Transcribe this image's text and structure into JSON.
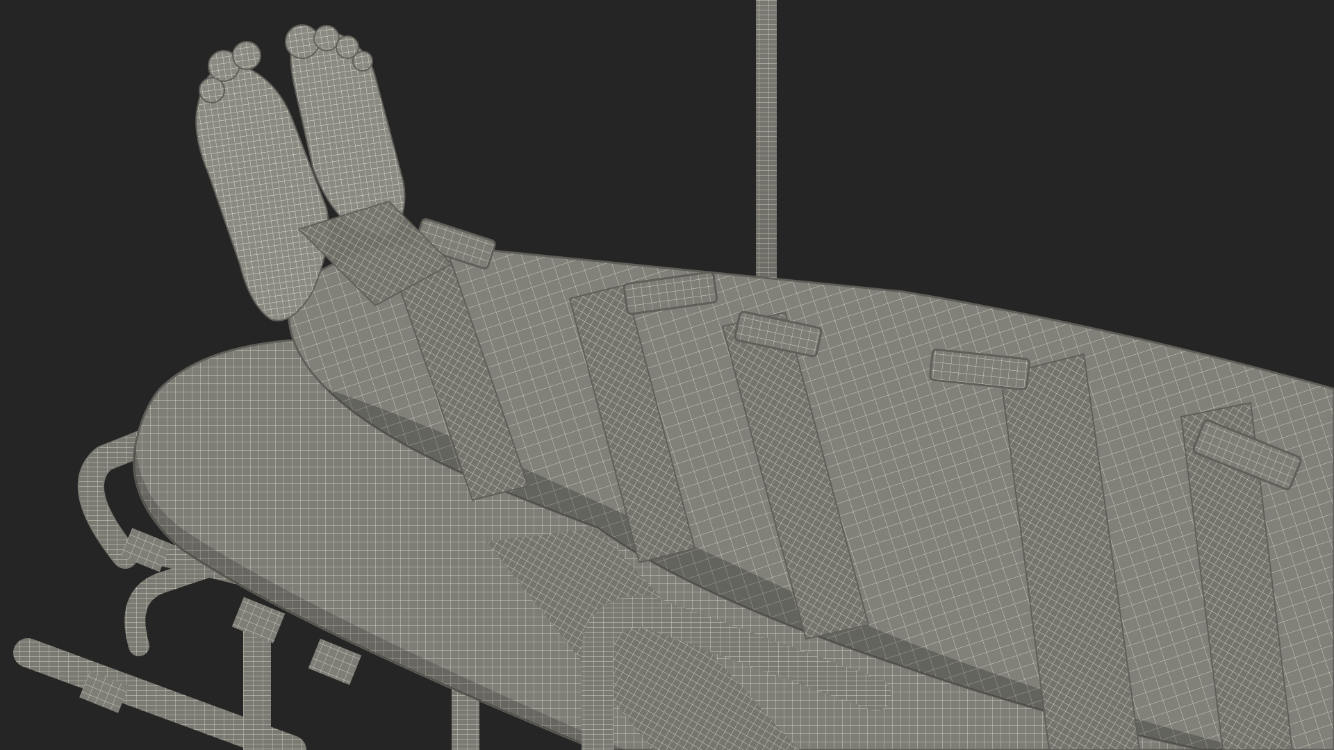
{
  "scene": {
    "subject": "wireframe-render",
    "colors": {
      "background": "#252525",
      "surface": "#7e7d76",
      "surface_dark": "#5f5e58",
      "surface_light": "#96958e",
      "wire": "#e6e4d2",
      "shadow": "#1a1a1a"
    },
    "parts": [
      "iv-pole",
      "stretcher-frame",
      "mattress",
      "restrained-legs",
      "feet",
      "straps",
      "buckles"
    ]
  }
}
